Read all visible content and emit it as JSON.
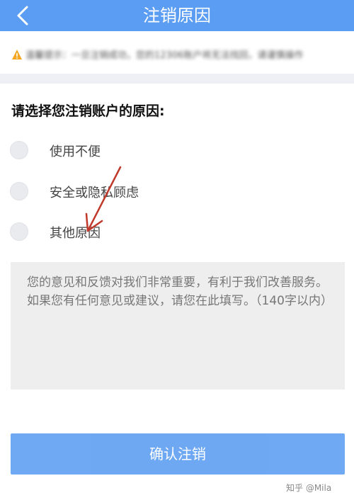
{
  "header": {
    "title": "注销原因",
    "back_icon": "chevron-left-icon",
    "background_color": "#5b9df2"
  },
  "notice": {
    "icon": "warning-icon",
    "text": "温馨提示：一旦注销成功，您的12306账户将无法找回，请谨慎操作"
  },
  "form": {
    "question": "请选择您注销账户的原因:",
    "options": [
      {
        "label": "使用不便",
        "selected": false
      },
      {
        "label": "安全或隐私顾虑",
        "selected": false
      },
      {
        "label": "其他原因",
        "selected": false
      }
    ],
    "feedback": {
      "value": "",
      "placeholder": "您的意见和反馈对我们非常重要，有利于我们改善服务。如果您有任何意见或建议，请您在此填写。（140字以内）"
    }
  },
  "actions": {
    "confirm_label": "确认注销"
  },
  "watermark": {
    "text": "知乎 @Mila"
  },
  "colors": {
    "accent": "#5b9df2",
    "annotation_arrow": "#c0392b"
  }
}
